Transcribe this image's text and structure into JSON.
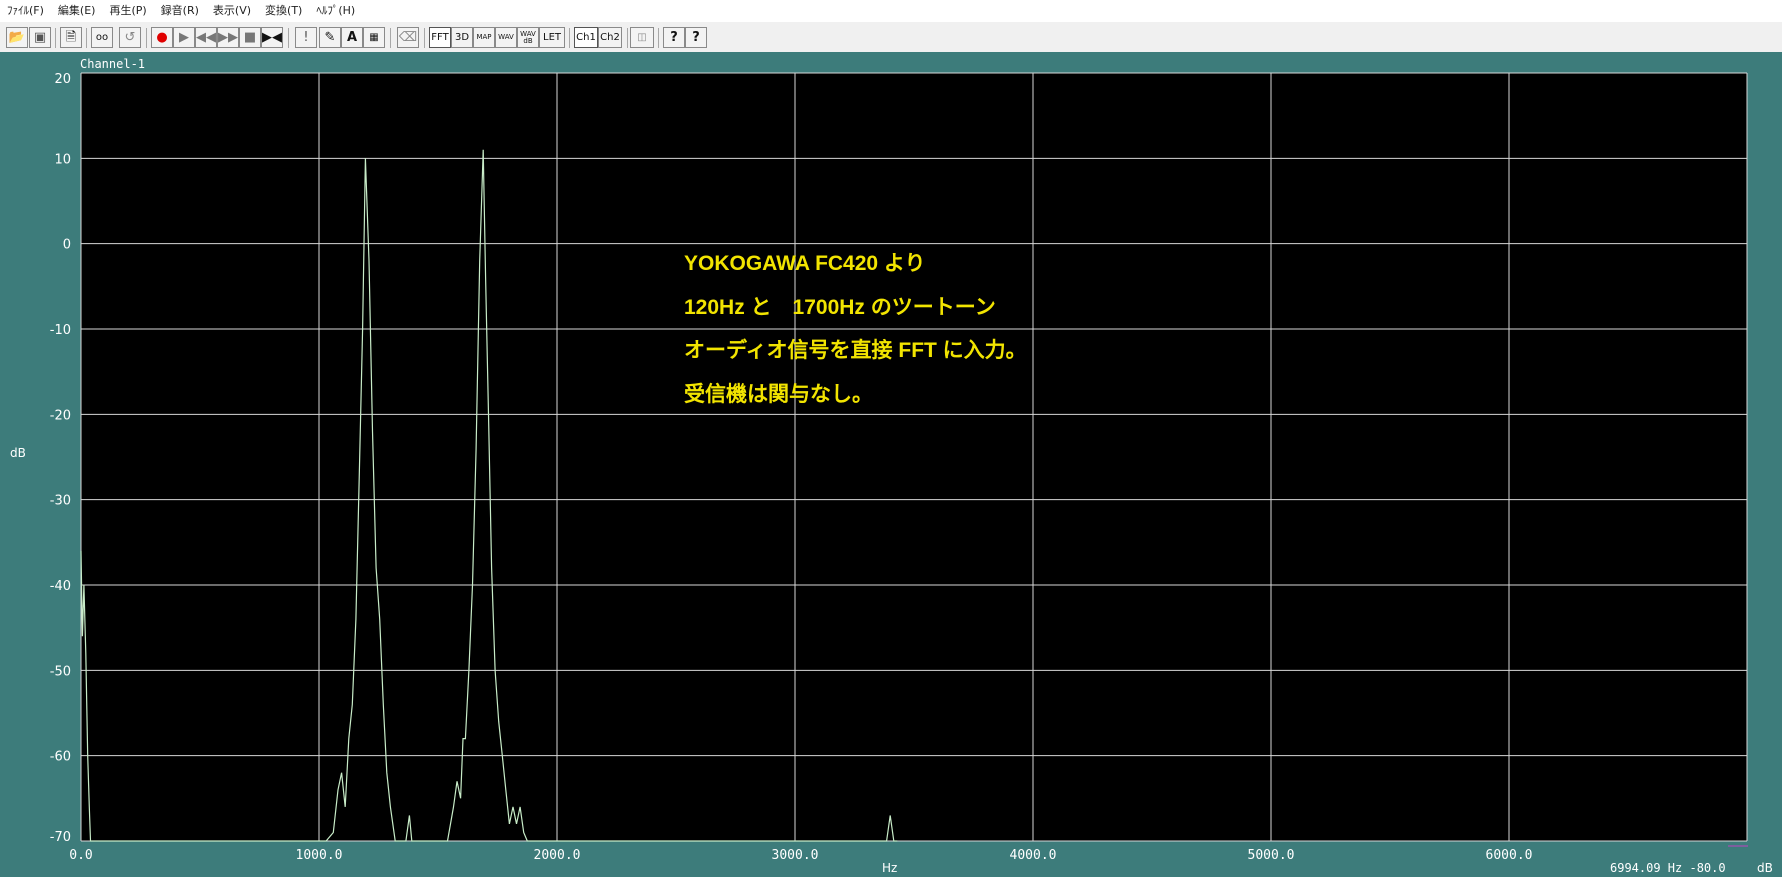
{
  "menu": [
    "ﾌｧｲﾙ(F)",
    "編集(E)",
    "再生(P)",
    "録音(R)",
    "表示(V)",
    "変換(T)",
    "ﾍﾙﾌﾟ(H)"
  ],
  "toolbar": {
    "fft": "FFT",
    "three_d": "3D",
    "map": "MAP",
    "wav": "WAV",
    "wav_db_top": "WAV",
    "wav_db_bottom": "dB",
    "let": "LET",
    "ch1": "Ch1",
    "ch2": "Ch2",
    "help": "?",
    "help_pointer": "?"
  },
  "window": {
    "channel_label": "Channel-1"
  },
  "overlay_text": [
    "YOKOGAWA FC420 より",
    "120Hz と　1700Hz のツートーン",
    "オーディオ信号を直接 FFT に入力。",
    "受信機は関与なし。"
  ],
  "status": {
    "readout": "6994.09 Hz -80.0",
    "readout_unit": "dB"
  },
  "chart_data": {
    "type": "line",
    "title": "Channel-1",
    "xlabel": "Hz",
    "ylabel": "dB",
    "xlim": [
      0,
      7000
    ],
    "ylim": [
      -70,
      20
    ],
    "x_ticks": [
      0,
      1000,
      2000,
      3000,
      4000,
      5000,
      6000
    ],
    "x_tick_labels": [
      "0.0",
      "1000.0",
      "2000.0",
      "3000.0",
      "4000.0",
      "5000.0",
      "6000.0"
    ],
    "y_ticks": [
      20,
      10,
      0,
      -10,
      -20,
      -30,
      -40,
      -50,
      -60,
      -70
    ],
    "y_tick_labels": [
      "20",
      "10",
      "0",
      "-10",
      "-20",
      "-30",
      "-40",
      "-50",
      "-60",
      "-70"
    ],
    "grid": true,
    "background": "#000000",
    "grid_color": "#d8d8d8",
    "trace_color": "#c8ecc8",
    "frame_color": "#3d7c7b",
    "series": [
      {
        "x": [
          0,
          6,
          12,
          20,
          28,
          35,
          40,
          1030,
          1060,
          1080,
          1095,
          1110,
          1125,
          1140,
          1155,
          1170,
          1183,
          1195,
          1210,
          1225,
          1240,
          1255,
          1270,
          1285,
          1300,
          1320,
          1345,
          1365,
          1380,
          1390,
          1400,
          1410,
          1420,
          1540,
          1565,
          1580,
          1595,
          1605,
          1615,
          1630,
          1645,
          1660,
          1675,
          1690,
          1700,
          1712,
          1725,
          1740,
          1755,
          1770,
          1785,
          1800,
          1815,
          1830,
          1845,
          1860,
          1875,
          1890,
          3370,
          3385,
          3400,
          3415,
          3430
        ],
        "y": [
          -36,
          -46,
          -40,
          -48,
          -60,
          -66,
          -70,
          -70,
          -69,
          -64,
          -62,
          -66,
          -58,
          -54,
          -44,
          -26,
          -10,
          10,
          -2,
          -22,
          -38,
          -44,
          -54,
          -62,
          -66,
          -70,
          -72,
          -70,
          -67,
          -70,
          -72,
          -71,
          -72,
          -70,
          -66,
          -63,
          -65,
          -58,
          -58,
          -50,
          -40,
          -24,
          -2,
          11,
          -4,
          -20,
          -38,
          -50,
          -56,
          -60,
          -64,
          -68,
          -66,
          -68,
          -66,
          -69,
          -70,
          -72,
          -72,
          -70,
          -67,
          -70,
          -72
        ]
      }
    ]
  }
}
